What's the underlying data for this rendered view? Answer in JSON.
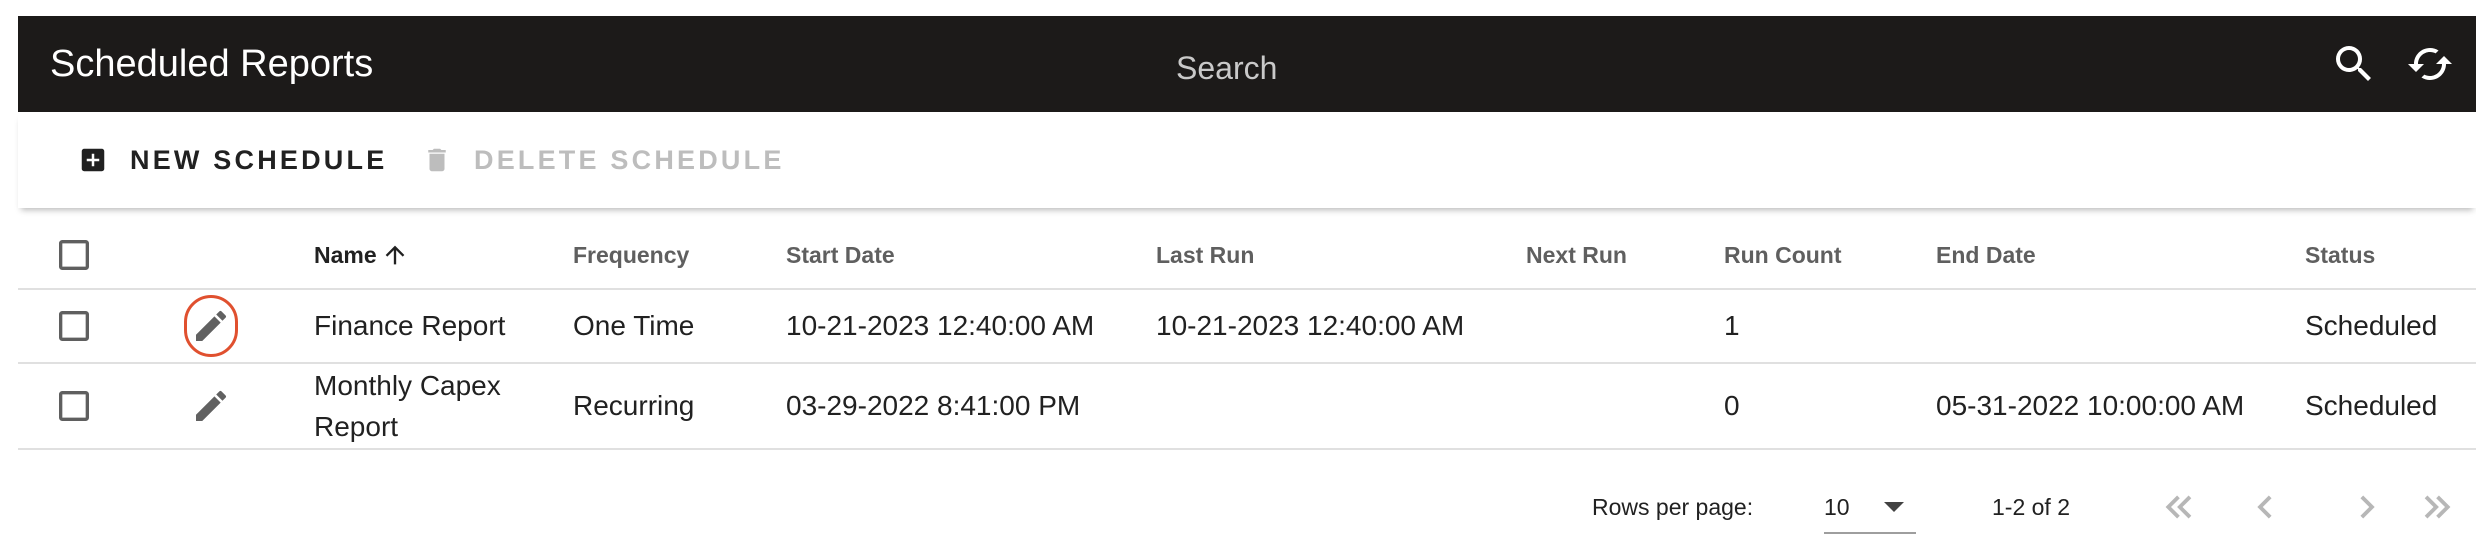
{
  "header": {
    "title": "Scheduled Reports",
    "search_placeholder": "Search",
    "search_value": "",
    "search_icon": "search-icon",
    "refresh_icon": "refresh-icon"
  },
  "toolbar": {
    "new_label": "NEW SCHEDULE",
    "new_icon": "add-box-icon",
    "delete_label": "DELETE SCHEDULE",
    "delete_icon": "trash-icon",
    "delete_disabled": true
  },
  "table": {
    "columns": {
      "name": "Name",
      "frequency": "Frequency",
      "start_date": "Start Date",
      "last_run": "Last Run",
      "next_run": "Next Run",
      "run_count": "Run Count",
      "end_date": "End Date",
      "status": "Status"
    },
    "sort": {
      "column": "name",
      "direction": "ascending",
      "icon": "arrow-up-icon"
    },
    "rows": [
      {
        "name": "Finance Report",
        "frequency": "One Time",
        "start_date": "10-21-2023 12:40:00 AM",
        "last_run": "10-21-2023 12:40:00 AM",
        "next_run": "",
        "run_count": "1",
        "end_date": "",
        "status": "Scheduled",
        "checked": false,
        "edit_icon": "pencil-icon"
      },
      {
        "name": "Monthly Capex Report",
        "frequency": "Recurring",
        "start_date": "03-29-2022 8:41:00 PM",
        "last_run": "",
        "next_run": "",
        "run_count": "0",
        "end_date": "05-31-2022 10:00:00 AM",
        "status": "Scheduled",
        "checked": false,
        "edit_icon": "pencil-icon"
      }
    ]
  },
  "pagination": {
    "rows_per_page_label": "Rows per page:",
    "rows_per_page": "10",
    "range": "1-2 of 2"
  },
  "colors": {
    "header_bg": "#1c1a19",
    "highlight": "#e0502f",
    "disabled_text": "#bdbdbd"
  }
}
